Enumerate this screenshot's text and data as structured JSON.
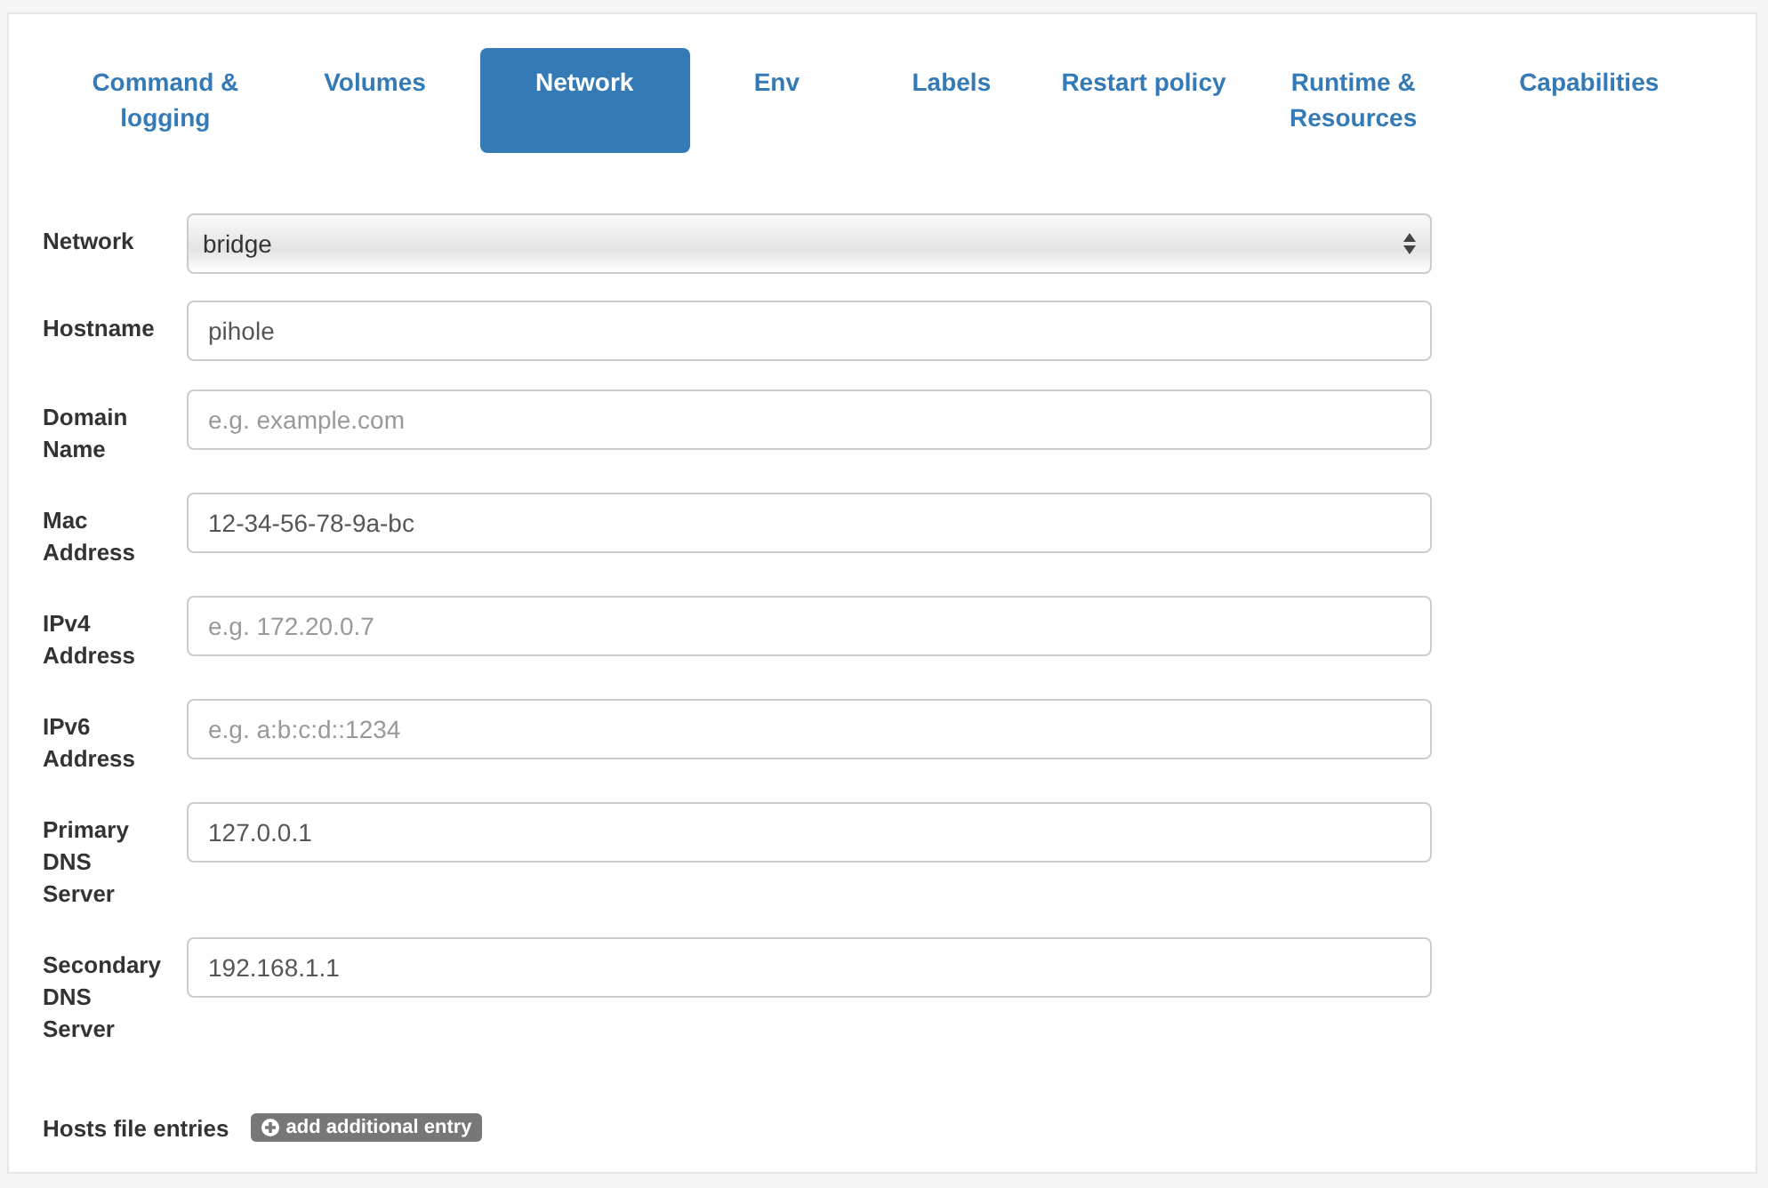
{
  "tabs": [
    {
      "label": "Command & logging",
      "selected": false
    },
    {
      "label": "Volumes",
      "selected": false
    },
    {
      "label": "Network",
      "selected": true
    },
    {
      "label": "Env",
      "selected": false
    },
    {
      "label": "Labels",
      "selected": false
    },
    {
      "label": "Restart policy",
      "selected": false
    },
    {
      "label": "Runtime & Resources",
      "selected": false
    },
    {
      "label": "Capabilities",
      "selected": false
    }
  ],
  "fields": [
    {
      "label": "Network",
      "kind": "select",
      "value": "bridge"
    },
    {
      "label": "Hostname",
      "kind": "text",
      "value": "pihole"
    },
    {
      "label": "Domain Name",
      "kind": "text",
      "placeholder": "e.g. example.com"
    },
    {
      "label": "Mac Address",
      "kind": "text",
      "value": "12-34-56-78-9a-bc"
    },
    {
      "label": "IPv4 Address",
      "kind": "text",
      "placeholder": "e.g. 172.20.0.7"
    },
    {
      "label": "IPv6 Address",
      "kind": "text",
      "placeholder": "e.g. a:b:c:d::1234"
    },
    {
      "label": "Primary DNS Server",
      "kind": "text",
      "value": "127.0.0.1"
    },
    {
      "label": "Secondary DNS Server",
      "kind": "text",
      "value": "192.168.1.1"
    }
  ],
  "hosts": {
    "label": "Hosts file entries",
    "button": "add additional entry"
  }
}
